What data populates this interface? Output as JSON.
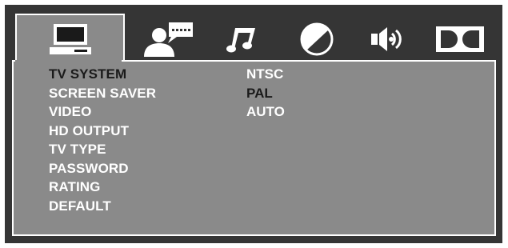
{
  "tabs": [
    {
      "icon": "monitor-icon",
      "active": true
    },
    {
      "icon": "person-speech-icon",
      "active": false
    },
    {
      "icon": "music-note-icon",
      "active": false
    },
    {
      "icon": "half-circle-icon",
      "active": false
    },
    {
      "icon": "speaker-icon",
      "active": false
    },
    {
      "icon": "dolby-logo-icon",
      "active": false
    }
  ],
  "menu": {
    "items": [
      {
        "label": "TV SYSTEM",
        "selected": true
      },
      {
        "label": "SCREEN SAVER",
        "selected": false
      },
      {
        "label": "VIDEO",
        "selected": false
      },
      {
        "label": "HD OUTPUT",
        "selected": false
      },
      {
        "label": "TV TYPE",
        "selected": false
      },
      {
        "label": "PASSWORD",
        "selected": false
      },
      {
        "label": "RATING",
        "selected": false
      },
      {
        "label": "DEFAULT",
        "selected": false
      }
    ]
  },
  "options": {
    "items": [
      {
        "label": "NTSC",
        "selected": false
      },
      {
        "label": "PAL",
        "selected": true
      },
      {
        "label": "AUTO",
        "selected": false
      }
    ]
  },
  "colors": {
    "frame": "#353535",
    "panel": "#8a8a8a",
    "text": "#ffffff",
    "selected_text": "#1a1a1a"
  }
}
